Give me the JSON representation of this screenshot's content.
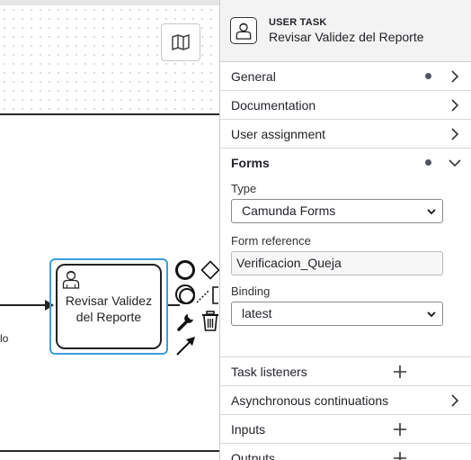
{
  "canvas": {
    "edge_label": "lo",
    "task": {
      "label_line1": "Revisar Validez",
      "label_line2": "del Reporte"
    },
    "icons": {
      "map": "map-icon",
      "user": "user-icon",
      "end_event": "end-event-icon",
      "gateway": "gateway-icon",
      "intermediate_event": "intermediate-event-icon",
      "wrench": "wrench-icon",
      "trash": "trash-icon",
      "connect": "connect-arrow-icon"
    }
  },
  "panel": {
    "header": {
      "type": "USER TASK",
      "name": "Revisar Validez del Reporte"
    },
    "groups": {
      "general": "General",
      "documentation": "Documentation",
      "user_assignment": "User assignment",
      "forms": "Forms",
      "task_listeners": "Task listeners",
      "async": "Asynchronous continuations",
      "inputs": "Inputs",
      "outputs": "Outputs"
    },
    "forms": {
      "type_label": "Type",
      "type_value": "Camunda Forms",
      "reference_label": "Form reference",
      "reference_value": "Verificacion_Queja",
      "binding_label": "Binding",
      "binding_value": "latest"
    }
  },
  "colors": {
    "selection": "#3d9ed9",
    "header_bg": "#f3f3f3",
    "dot": "#52555f"
  }
}
